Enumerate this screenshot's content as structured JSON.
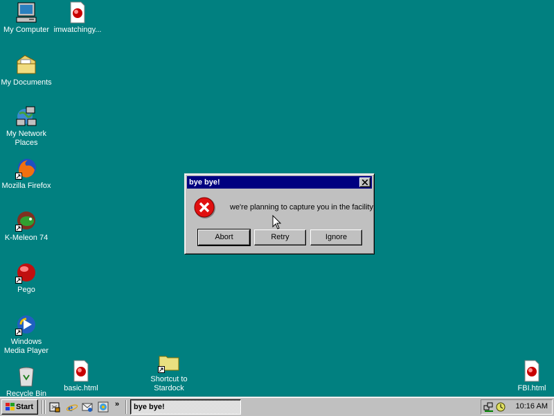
{
  "desktop": {
    "background_color": "#018080",
    "icons": [
      {
        "label": "My Computer",
        "icon": "my-computer-icon"
      },
      {
        "label": "imwatchingy...",
        "icon": "html-document-icon"
      },
      {
        "label": "My Documents",
        "icon": "my-documents-folder-icon"
      },
      {
        "label": "My Network\nPlaces",
        "icon": "network-places-icon"
      },
      {
        "label": "Mozilla Firefox",
        "icon": "firefox-icon"
      },
      {
        "label": "K-Meleon 74",
        "icon": "k-meleon-icon"
      },
      {
        "label": "Pego",
        "icon": "pego-icon"
      },
      {
        "label": "Windows\nMedia Player",
        "icon": "media-player-icon"
      },
      {
        "label": "Recycle Bin",
        "icon": "recycle-bin-icon"
      },
      {
        "label": "basic.html",
        "icon": "html-document-icon"
      },
      {
        "label": "Shortcut to\nStardock",
        "icon": "folder-shortcut-icon"
      },
      {
        "label": "FBI.html",
        "icon": "html-document-icon"
      }
    ]
  },
  "dialog": {
    "title": "bye bye!",
    "message": "we're planning to capture you in the facility",
    "icon": "error-icon",
    "buttons": {
      "abort": "Abort",
      "retry": "Retry",
      "ignore": "Ignore"
    }
  },
  "taskbar": {
    "start_label": "Start",
    "quick_launch": [
      "show-desktop-icon",
      "internet-explorer-icon",
      "outlook-express-icon",
      "channels-icon"
    ],
    "chevron": "»",
    "task_label": "bye bye!",
    "clock": "10:16 AM"
  },
  "colors": {
    "titlebar": "#000080",
    "face": "#c0c0c0",
    "error_red": "#e01010"
  }
}
